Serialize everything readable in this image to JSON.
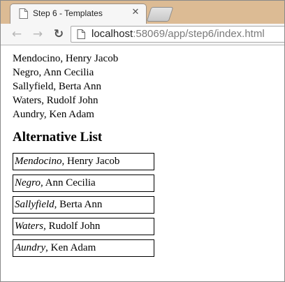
{
  "browser": {
    "tab_title": "Step 6 - Templates",
    "close_glyph": "✕",
    "url_host": "localhost",
    "url_rest": ":58069/app/step6/index.html",
    "icons": {
      "back": "back-arrow-icon",
      "forward": "forward-arrow-icon",
      "reload": "reload-icon",
      "page": "page-icon"
    },
    "titlebar_color": "#dcbb94"
  },
  "page": {
    "names": [
      {
        "last": "Mendocino",
        "first": "Henry Jacob"
      },
      {
        "last": "Negro",
        "first": "Ann Cecilia"
      },
      {
        "last": "Sallyfield",
        "first": "Berta Ann"
      },
      {
        "last": "Waters",
        "first": "Rudolf John"
      },
      {
        "last": "Aundry",
        "first": "Ken Adam"
      }
    ],
    "simple_list": [
      "Mendocino, Henry Jacob",
      "Negro, Ann Cecilia",
      "Sallyfield, Berta Ann",
      "Waters, Rudolf John",
      "Aundry, Ken Adam"
    ],
    "alt_heading": "Alternative List"
  }
}
